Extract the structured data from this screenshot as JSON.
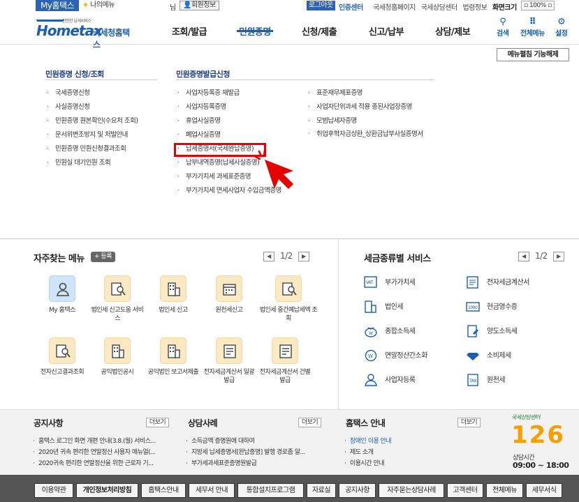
{
  "topbar": {
    "my_hometax": "My홈택스",
    "my_menu": "나의메뉴",
    "nim": "님",
    "member_info": "회원정보",
    "logout": "로그아웃",
    "certificate_center": "인증센터",
    "links": [
      "국세청홈페이지",
      "국세상담센터",
      "법령정보",
      "화면크기"
    ],
    "zoom": "100%"
  },
  "header": {
    "logo_small": "안전한 납세서비스",
    "logo_text": "Hometax",
    "logo_kr": "국세청홈택스",
    "nav": [
      "조회/발급",
      "민원증명",
      "신청/제출",
      "신고/납부",
      "상담/제보"
    ],
    "active_nav": "민원증명",
    "search": "검색",
    "all_menu": "전체메뉴",
    "settings": "설정"
  },
  "megamenu": {
    "release_button": "메뉴펼침 기능해제",
    "col1_title": "민원증명 신청/조회",
    "col1_items": [
      "국세증명신청",
      "사실증명신청",
      "민원증명 원본확인(수요처 조회)",
      "문서위변조방지 및 처벌안내",
      "민원증명 민원신청결과조회",
      "민원실 대기인원 조회"
    ],
    "col2_title": "민원증명발급신청",
    "col2_items": [
      "사업자등록증 재발급",
      "사업자등록증명",
      "휴업사실증명",
      "폐업사실증명",
      "납세증명서(국세완납증명)",
      "납부내역증명(납세사실증명)",
      "부가가치세 과세표준증명",
      "부가가치세 면세사업자 수입금액증명"
    ],
    "col3_items": [
      "표준재무제표증명",
      "사업자단위과세 적용 종된사업장증명",
      "모범납세자증명",
      "취업후학자금상환_상환금납부사실증명서"
    ]
  },
  "favorites": {
    "title": "자주찾는 메뉴",
    "register": "등록",
    "page": "1/2",
    "items": [
      {
        "label": "My 홈택스",
        "icon": "person-icon"
      },
      {
        "label": "법인세 신고도움 서비스",
        "icon": "doc-search-icon"
      },
      {
        "label": "법인세 신고",
        "icon": "building-icon"
      },
      {
        "label": "원천세신고",
        "icon": "calendar-icon"
      },
      {
        "label": "법인세 중간예납세액 조회",
        "icon": "doc-search-icon"
      },
      {
        "label": "전자신고결과조회",
        "icon": "doc-search-icon"
      },
      {
        "label": "공익법인공시",
        "icon": "building-icon"
      },
      {
        "label": "공익법인 보고서제출",
        "icon": "building-icon"
      },
      {
        "label": "전자세금계산서 일괄발급",
        "icon": "invoice-icon"
      },
      {
        "label": "전자세금계산서 건별발급",
        "icon": "invoice-icon"
      }
    ]
  },
  "tax_services": {
    "title": "세금종류별 서비스",
    "page": "1/2",
    "items": [
      {
        "label": "부가가치세",
        "icon": "vat-icon"
      },
      {
        "label": "전자세금계산서",
        "icon": "invoice-icon"
      },
      {
        "label": "법인세",
        "icon": "building-icon"
      },
      {
        "label": "현금영수증",
        "icon": "receipt-icon"
      },
      {
        "label": "종합소득세",
        "icon": "money-bag-icon"
      },
      {
        "label": "양도소득세",
        "icon": "transfer-doc-icon"
      },
      {
        "label": "연말정산간소화",
        "icon": "calculator-icon"
      },
      {
        "label": "소비제세",
        "icon": "diamond-icon"
      },
      {
        "label": "사업자등록",
        "icon": "person-icon"
      },
      {
        "label": "원천세",
        "icon": "tax-doc-icon"
      }
    ]
  },
  "notices": {
    "title": "공지사항",
    "more": "더보기",
    "items": [
      "홈택스 로그인 화면 개편 안내(3.8.(월) 서비스...",
      "2020년 귀속 편리한 연말정산 사용자 매뉴얼(...",
      "2020귀속 편리한 연말정산을 위한 근로자 기..."
    ]
  },
  "consult": {
    "title": "상담사례",
    "more": "더보기",
    "items": [
      "소득금액 증명원에 대하여",
      "지방세 납세증명서[완납증명] 발행 경로좀 알...",
      "부가세과세표준증명원발급"
    ]
  },
  "guide": {
    "title": "홈택스 안내",
    "more": "더보기",
    "items": [
      "장애인 이용 안내",
      "제도 소개",
      "이용시간 안내"
    ]
  },
  "center": {
    "brand": "국세상담센터",
    "number": "126",
    "hours_label": "상담시간",
    "hours": "09:00 ~ 18:00"
  },
  "footer": {
    "links": [
      "이용약관",
      "개인정보처리방침",
      "홈택스안내",
      "세무서 안내",
      "통합설치프로그램",
      "자료실",
      "공지사항",
      "자주묻는상담사례",
      "고객센터",
      "전체메뉴",
      "세무서식"
    ]
  },
  "colors": {
    "brand": "#1d5fae",
    "highlight": "#e50000",
    "footer_bg": "#555555"
  }
}
